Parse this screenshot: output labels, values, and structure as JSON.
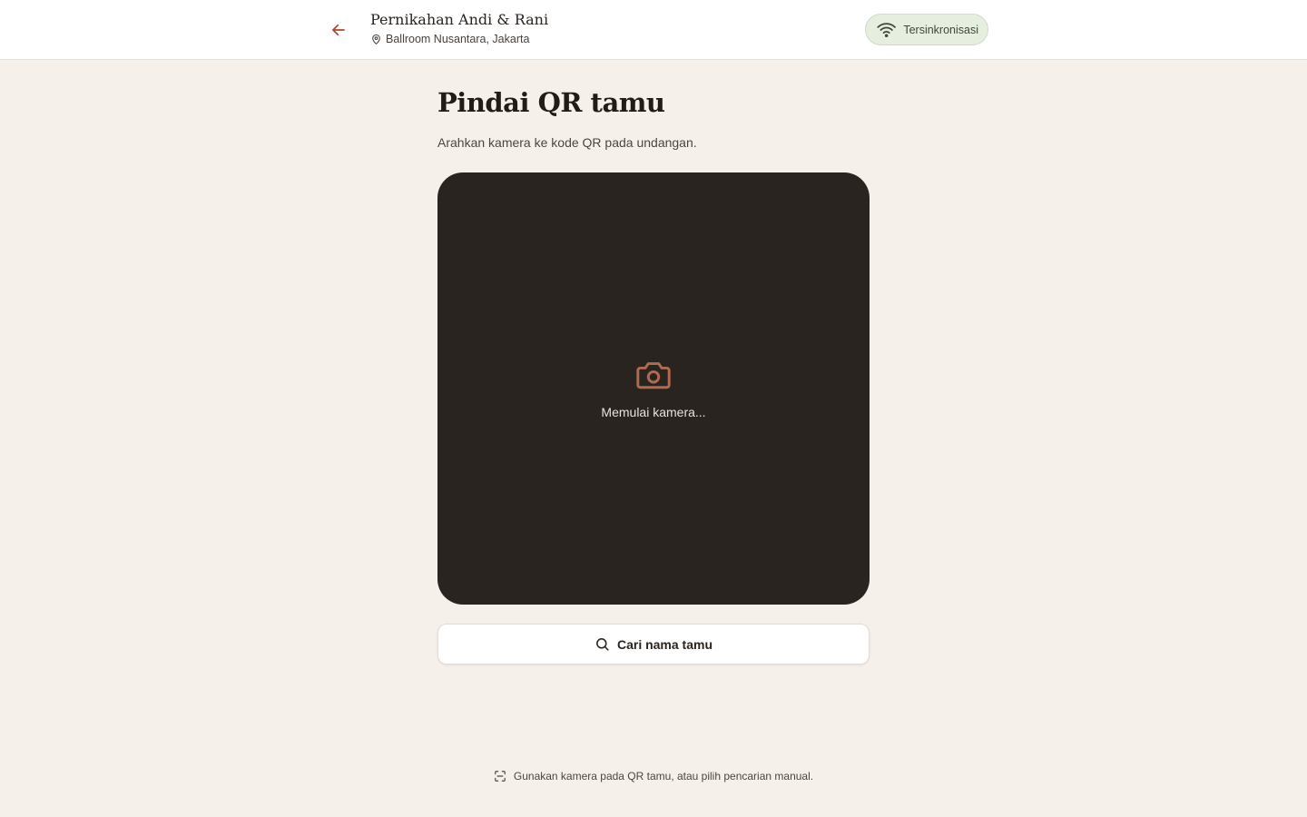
{
  "header": {
    "event_title": "Pernikahan Andi & Rani",
    "venue": "Ballroom Nusantara, Jakarta",
    "sync_status": "Tersinkronisasi"
  },
  "main": {
    "title": "Pindai QR tamu",
    "subtitle": "Arahkan kamera ke kode QR pada undangan.",
    "camera_status": "Memulai kamera...",
    "search_button_label": "Cari nama tamu"
  },
  "footer": {
    "hint": "Gunakan kamera pada QR tamu, atau pilih pencarian manual."
  },
  "icons": {
    "back": "arrow-left-icon",
    "venue": "map-pin-icon",
    "sync": "wifi-icon",
    "camera": "camera-icon",
    "search": "search-icon",
    "scan": "scan-frame-icon"
  },
  "colors": {
    "background": "#f6f0ea",
    "accent": "#a8472e",
    "camera_bg": "#2a2420",
    "camera_icon": "#b06a4f",
    "sync_bg": "#e6eee0"
  }
}
